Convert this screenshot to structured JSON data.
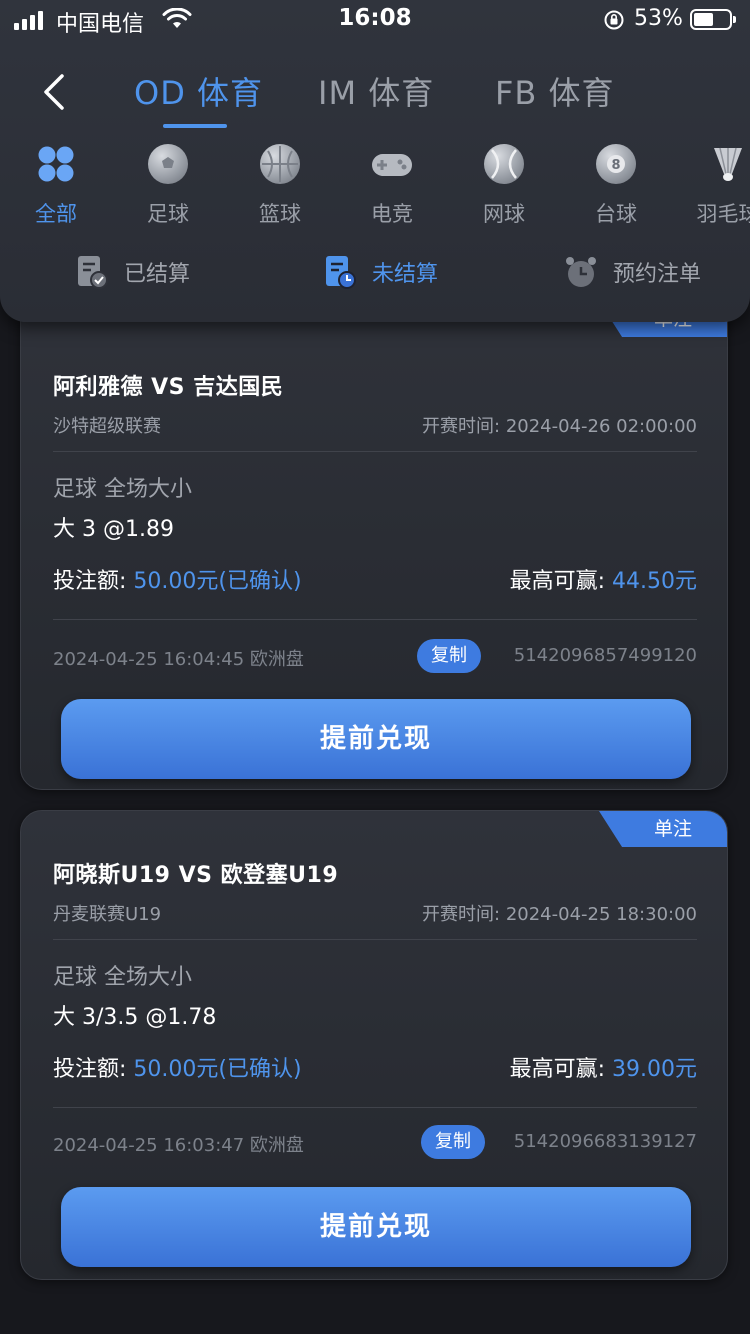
{
  "status_bar": {
    "carrier": "中国电信",
    "time": "16:08",
    "battery": "53%"
  },
  "header": {
    "tabs": [
      {
        "label": "OD 体育"
      },
      {
        "label": "IM 体育"
      },
      {
        "label": "FB 体育"
      }
    ],
    "sports": [
      {
        "label": "全部",
        "icon": "grid-icon"
      },
      {
        "label": "足球",
        "icon": "soccer-ball-icon"
      },
      {
        "label": "篮球",
        "icon": "basketball-icon"
      },
      {
        "label": "电竞",
        "icon": "gamepad-icon"
      },
      {
        "label": "网球",
        "icon": "tennis-ball-icon"
      },
      {
        "label": "台球",
        "icon": "billiard-ball-icon"
      },
      {
        "label": "羽毛球",
        "icon": "shuttlecock-icon"
      }
    ],
    "subtabs": [
      {
        "label": "已结算"
      },
      {
        "label": "未结算"
      },
      {
        "label": "预约注单"
      }
    ]
  },
  "colors": {
    "accent": "#4f94ec",
    "card_bg": "#2b2e35",
    "page_bg": "#17181d"
  },
  "bets": [
    {
      "badge": "单注",
      "match": "阿利雅德 VS 吉达国民",
      "league": "沙特超级联赛",
      "start_label": "开赛时间:",
      "start_time": "2024-04-26 02:00:00",
      "market": "足球 全场大小",
      "pick": "大 3 @1.89",
      "stake_label": "投注额:",
      "stake_value": "50.00元(已确认)",
      "win_label": "最高可赢:",
      "win_value": "44.50元",
      "placed": "2024-04-25 16:04:45 欧洲盘",
      "copy_label": "复制",
      "order_no": "5142096857499120",
      "cashout_label": "提前兑现"
    },
    {
      "badge": "单注",
      "match": "阿晓斯U19 VS 欧登塞U19",
      "league": "丹麦联赛U19",
      "start_label": "开赛时间:",
      "start_time": "2024-04-25 18:30:00",
      "market": "足球 全场大小",
      "pick": "大 3/3.5 @1.78",
      "stake_label": "投注额:",
      "stake_value": "50.00元(已确认)",
      "win_label": "最高可赢:",
      "win_value": "39.00元",
      "placed": "2024-04-25 16:03:47 欧洲盘",
      "copy_label": "复制",
      "order_no": "5142096683139127",
      "cashout_label": "提前兑现"
    }
  ]
}
